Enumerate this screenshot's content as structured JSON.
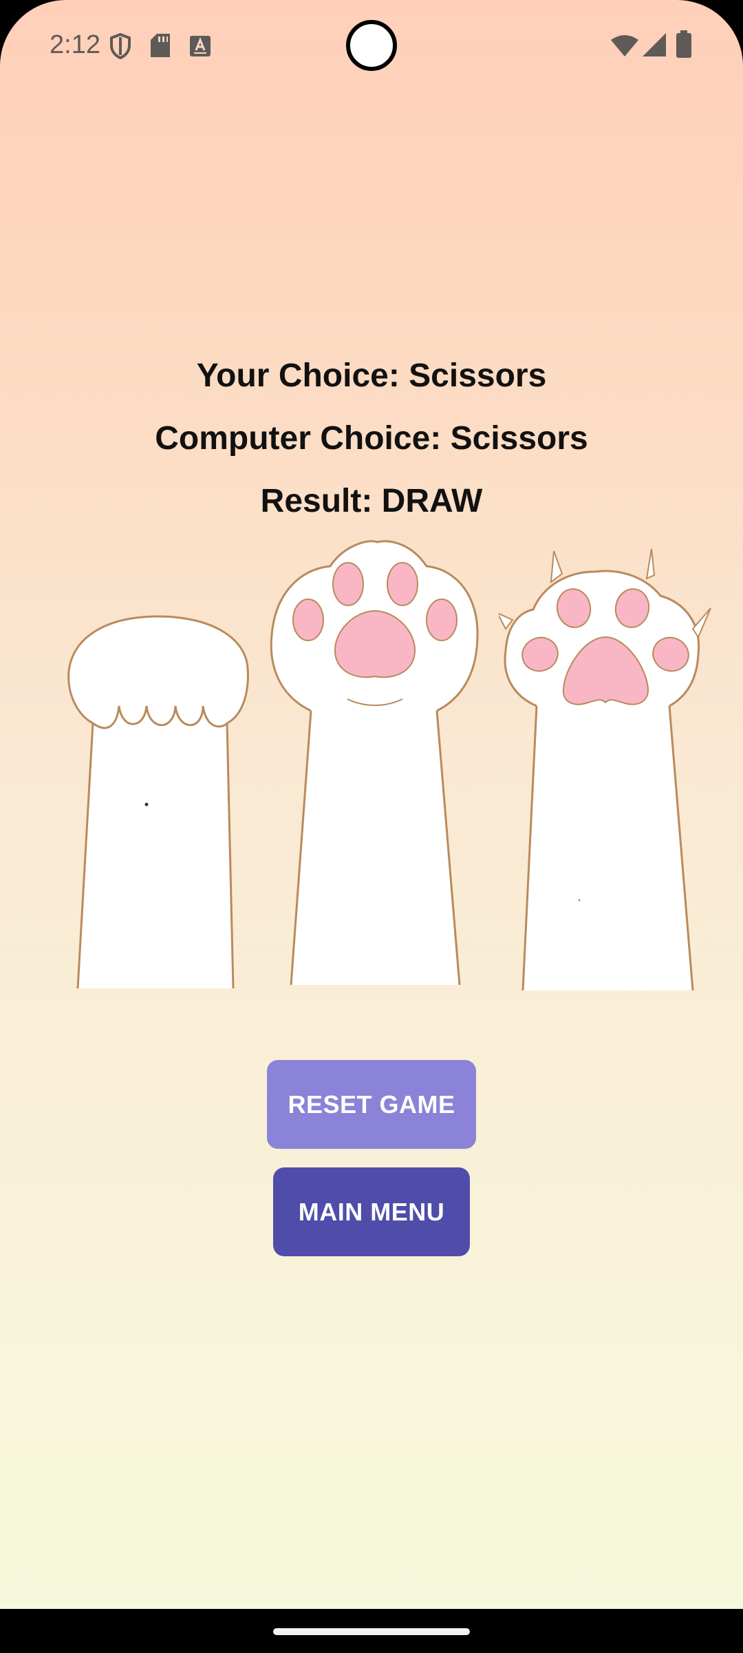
{
  "status_bar": {
    "time": "2:12",
    "icons": [
      "shield-icon",
      "sd-card-icon",
      "keyboard-a-icon",
      "wifi-icon",
      "cell-signal-icon",
      "battery-icon"
    ]
  },
  "game": {
    "your_choice": "Your Choice: Scissors",
    "computer_choice": "Computer Choice: Scissors",
    "result": "Result: DRAW"
  },
  "choices": {
    "icons": [
      "rock-paw-icon",
      "paper-paw-icon",
      "scissors-paw-icon"
    ]
  },
  "buttons": {
    "reset": "RESET GAME",
    "main_menu": "MAIN MENU"
  },
  "colors": {
    "reset_button": "#8b83d8",
    "main_menu_button": "#504caa",
    "pad_pink": "#f9b6c4",
    "outline": "#b98a5c"
  }
}
